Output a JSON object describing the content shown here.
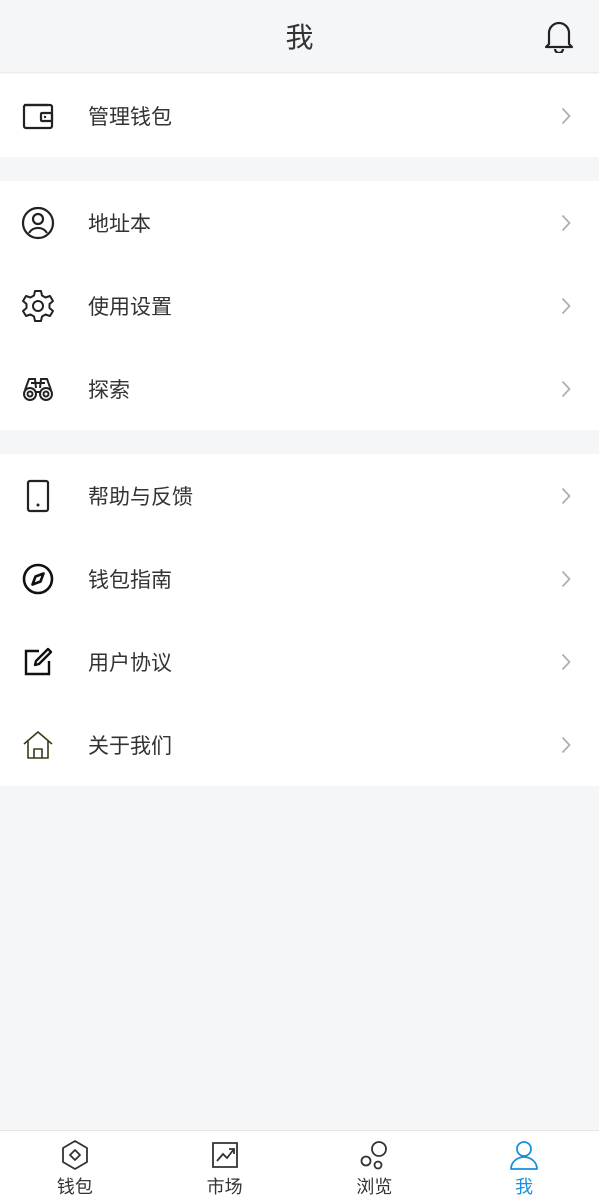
{
  "header": {
    "title": "我"
  },
  "groups": [
    {
      "items": [
        {
          "label": "管理钱包",
          "icon": "wallet-icon"
        }
      ]
    },
    {
      "items": [
        {
          "label": "地址本",
          "icon": "user-circle-icon"
        },
        {
          "label": "使用设置",
          "icon": "gear-icon"
        },
        {
          "label": "探索",
          "icon": "binoculars-icon"
        }
      ]
    },
    {
      "items": [
        {
          "label": "帮助与反馈",
          "icon": "phone-icon"
        },
        {
          "label": "钱包指南",
          "icon": "compass-icon"
        },
        {
          "label": "用户协议",
          "icon": "edit-icon"
        },
        {
          "label": "关于我们",
          "icon": "home-icon"
        }
      ]
    }
  ],
  "tabbar": {
    "tabs": [
      {
        "label": "钱包",
        "icon": "wallet-diamond-icon"
      },
      {
        "label": "市场",
        "icon": "chart-icon"
      },
      {
        "label": "浏览",
        "icon": "bubbles-icon"
      },
      {
        "label": "我",
        "icon": "person-icon",
        "active": true
      }
    ]
  },
  "colors": {
    "accent": "#1a8fdc",
    "background": "#f5f6f8",
    "chevron": "#b0b0b0"
  }
}
